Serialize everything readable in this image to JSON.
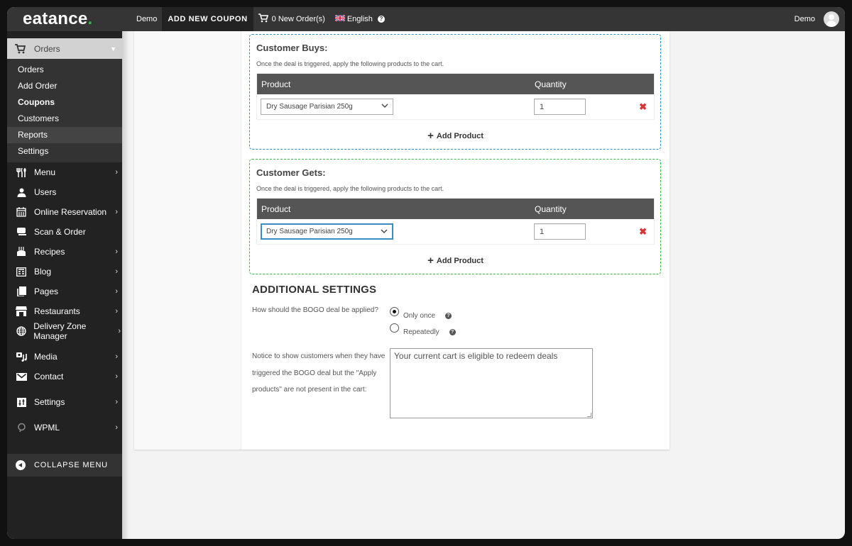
{
  "topbar": {
    "logo": "eatance",
    "logo_dot": ".",
    "site_name": "Demo",
    "page_title": "ADD NEW COUPON",
    "new_orders": "0 New Order(s)",
    "language": "English",
    "user_name": "Demo"
  },
  "sidebar": {
    "orders_header": "Orders",
    "orders_sub": [
      {
        "label": "Orders"
      },
      {
        "label": "Add Order"
      },
      {
        "label": "Coupons"
      },
      {
        "label": "Customers"
      },
      {
        "label": "Reports"
      },
      {
        "label": "Settings"
      }
    ],
    "items": [
      {
        "label": "Menu",
        "icon": "utensils-icon",
        "has_arrow": true
      },
      {
        "label": "Users",
        "icon": "user-icon",
        "has_arrow": false
      },
      {
        "label": "Online Reservation",
        "icon": "calendar-icon",
        "has_arrow": true
      },
      {
        "label": "Scan & Order",
        "icon": "scan-icon",
        "has_arrow": false
      },
      {
        "label": "Recipes",
        "icon": "cake-icon",
        "has_arrow": true
      },
      {
        "label": "Blog",
        "icon": "blog-icon",
        "has_arrow": true
      },
      {
        "label": "Pages",
        "icon": "pages-icon",
        "has_arrow": true
      },
      {
        "label": "Restaurants",
        "icon": "store-icon",
        "has_arrow": true
      },
      {
        "label": "Delivery Zone Manager",
        "icon": "globe-icon",
        "has_arrow": true
      },
      {
        "label": "Media",
        "icon": "media-icon",
        "has_arrow": true
      },
      {
        "label": "Contact",
        "icon": "envelope-icon",
        "has_arrow": true
      },
      {
        "label": "Settings",
        "icon": "sliders-icon",
        "has_arrow": true
      },
      {
        "label": "WPML",
        "icon": "wpml-icon",
        "has_arrow": true
      }
    ],
    "arrow": "›",
    "collapse_label": "COLLAPSE MENU"
  },
  "customer_buys": {
    "title": "Customer Buys:",
    "description": "Once the deal is triggered, apply the following products to the cart.",
    "col_product": "Product",
    "col_quantity": "Quantity",
    "rows": [
      {
        "product": "Dry Sausage Parisian 250g",
        "quantity": "1"
      }
    ],
    "add_label": "Add Product",
    "accent": "#2d8fc4"
  },
  "customer_gets": {
    "title": "Customer Gets:",
    "description": "Once the deal is triggered, apply the following products to the cart.",
    "col_product": "Product",
    "col_quantity": "Quantity",
    "rows": [
      {
        "product": "Dry Sausage Parisian 250g",
        "quantity": "1"
      }
    ],
    "add_label": "Add Product",
    "accent": "#3db54a"
  },
  "additional_settings": {
    "title": "ADDITIONAL SETTINGS",
    "apply_question": "How should the BOGO deal be applied?",
    "options": [
      {
        "label": "Only once",
        "checked": true
      },
      {
        "label": "Repeatedly",
        "checked": false
      }
    ],
    "notice_label": "Notice to show customers when they have triggered the BOGO deal but the \"Apply products\" are not present in the cart:",
    "notice_value": "Your current cart is eligible to redeem deals"
  },
  "icons": {
    "remove": "✖",
    "plus": "+",
    "chevron_down": "⌄",
    "help": "?"
  }
}
